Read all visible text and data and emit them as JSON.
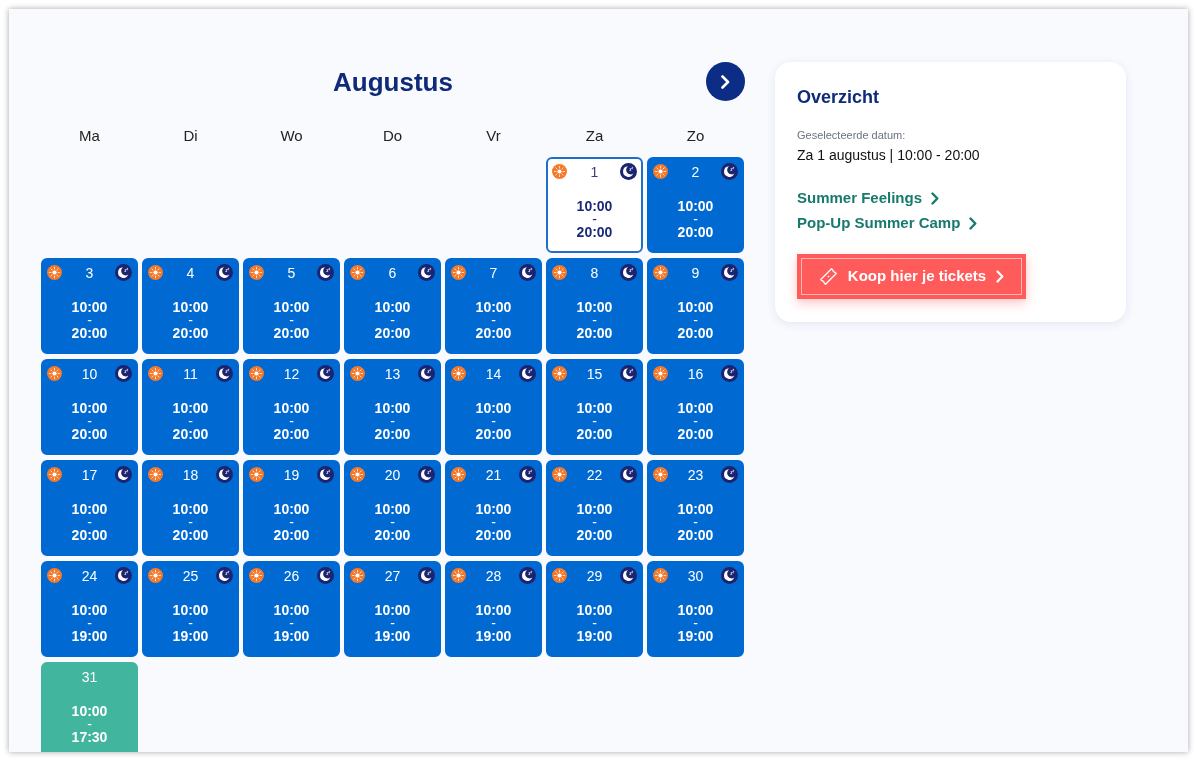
{
  "calendar": {
    "month": "Augustus",
    "weekdays": [
      "Ma",
      "Di",
      "Wo",
      "Do",
      "Vr",
      "Za",
      "Zo"
    ],
    "weeks": [
      {
        "days": [
          {
            "day": "1",
            "kind": "sun_moon",
            "selected": true,
            "opens": "10:00",
            "separator": "-",
            "closes": "20:00"
          },
          {
            "day": "2",
            "kind": "sun_moon",
            "selected": false,
            "opens": "10:00",
            "separator": "-",
            "closes": "20:00"
          }
        ]
      },
      {
        "days": [
          {
            "day": "3",
            "kind": "sun_moon",
            "selected": false,
            "opens": "10:00",
            "separator": "-",
            "closes": "20:00"
          },
          {
            "day": "4",
            "kind": "sun_moon",
            "selected": false,
            "opens": "10:00",
            "separator": "-",
            "closes": "20:00"
          },
          {
            "day": "5",
            "kind": "sun_moon",
            "selected": false,
            "opens": "10:00",
            "separator": "-",
            "closes": "20:00"
          },
          {
            "day": "6",
            "kind": "sun_moon",
            "selected": false,
            "opens": "10:00",
            "separator": "-",
            "closes": "20:00"
          },
          {
            "day": "7",
            "kind": "sun_moon",
            "selected": false,
            "opens": "10:00",
            "separator": "-",
            "closes": "20:00"
          },
          {
            "day": "8",
            "kind": "sun_moon",
            "selected": false,
            "opens": "10:00",
            "separator": "-",
            "closes": "20:00"
          },
          {
            "day": "9",
            "kind": "sun_moon",
            "selected": false,
            "opens": "10:00",
            "separator": "-",
            "closes": "20:00"
          }
        ]
      },
      {
        "days": [
          {
            "day": "10",
            "kind": "sun_moon",
            "selected": false,
            "opens": "10:00",
            "separator": "-",
            "closes": "20:00"
          },
          {
            "day": "11",
            "kind": "sun_moon",
            "selected": false,
            "opens": "10:00",
            "separator": "-",
            "closes": "20:00"
          },
          {
            "day": "12",
            "kind": "sun_moon",
            "selected": false,
            "opens": "10:00",
            "separator": "-",
            "closes": "20:00"
          },
          {
            "day": "13",
            "kind": "sun_moon",
            "selected": false,
            "opens": "10:00",
            "separator": "-",
            "closes": "20:00"
          },
          {
            "day": "14",
            "kind": "sun_moon",
            "selected": false,
            "opens": "10:00",
            "separator": "-",
            "closes": "20:00"
          },
          {
            "day": "15",
            "kind": "sun_moon",
            "selected": false,
            "opens": "10:00",
            "separator": "-",
            "closes": "20:00"
          },
          {
            "day": "16",
            "kind": "sun_moon",
            "selected": false,
            "opens": "10:00",
            "separator": "-",
            "closes": "20:00"
          }
        ]
      },
      {
        "days": [
          {
            "day": "17",
            "kind": "sun_moon",
            "selected": false,
            "opens": "10:00",
            "separator": "-",
            "closes": "20:00"
          },
          {
            "day": "18",
            "kind": "sun_moon",
            "selected": false,
            "opens": "10:00",
            "separator": "-",
            "closes": "20:00"
          },
          {
            "day": "19",
            "kind": "sun_moon",
            "selected": false,
            "opens": "10:00",
            "separator": "-",
            "closes": "20:00"
          },
          {
            "day": "20",
            "kind": "sun_moon",
            "selected": false,
            "opens": "10:00",
            "separator": "-",
            "closes": "20:00"
          },
          {
            "day": "21",
            "kind": "sun_moon",
            "selected": false,
            "opens": "10:00",
            "separator": "-",
            "closes": "20:00"
          },
          {
            "day": "22",
            "kind": "sun_moon",
            "selected": false,
            "opens": "10:00",
            "separator": "-",
            "closes": "20:00"
          },
          {
            "day": "23",
            "kind": "sun_moon",
            "selected": false,
            "opens": "10:00",
            "separator": "-",
            "closes": "20:00"
          }
        ]
      },
      {
        "days": [
          {
            "day": "24",
            "kind": "sun_moon",
            "selected": false,
            "opens": "10:00",
            "separator": "-",
            "closes": "19:00"
          },
          {
            "day": "25",
            "kind": "sun_moon",
            "selected": false,
            "opens": "10:00",
            "separator": "-",
            "closes": "19:00"
          },
          {
            "day": "26",
            "kind": "sun_moon",
            "selected": false,
            "opens": "10:00",
            "separator": "-",
            "closes": "19:00"
          },
          {
            "day": "27",
            "kind": "sun_moon",
            "selected": false,
            "opens": "10:00",
            "separator": "-",
            "closes": "19:00"
          },
          {
            "day": "28",
            "kind": "sun_moon",
            "selected": false,
            "opens": "10:00",
            "separator": "-",
            "closes": "19:00"
          },
          {
            "day": "29",
            "kind": "sun_moon",
            "selected": false,
            "opens": "10:00",
            "separator": "-",
            "closes": "19:00"
          },
          {
            "day": "30",
            "kind": "sun_moon",
            "selected": false,
            "opens": "10:00",
            "separator": "-",
            "closes": "19:00"
          }
        ]
      },
      {
        "days": [
          {
            "day": "31",
            "kind": "plain",
            "selected": false,
            "opens": "10:00",
            "separator": "-",
            "closes": "17:30"
          }
        ]
      }
    ]
  },
  "overview": {
    "title": "Overzicht",
    "date_label": "Geselecteerde datum:",
    "date_value": "Za 1 augustus | 10:00 - 20:00",
    "links": [
      "Summer Feelings",
      "Pop-Up Summer Camp"
    ],
    "button": "Koop hier je tickets"
  }
}
